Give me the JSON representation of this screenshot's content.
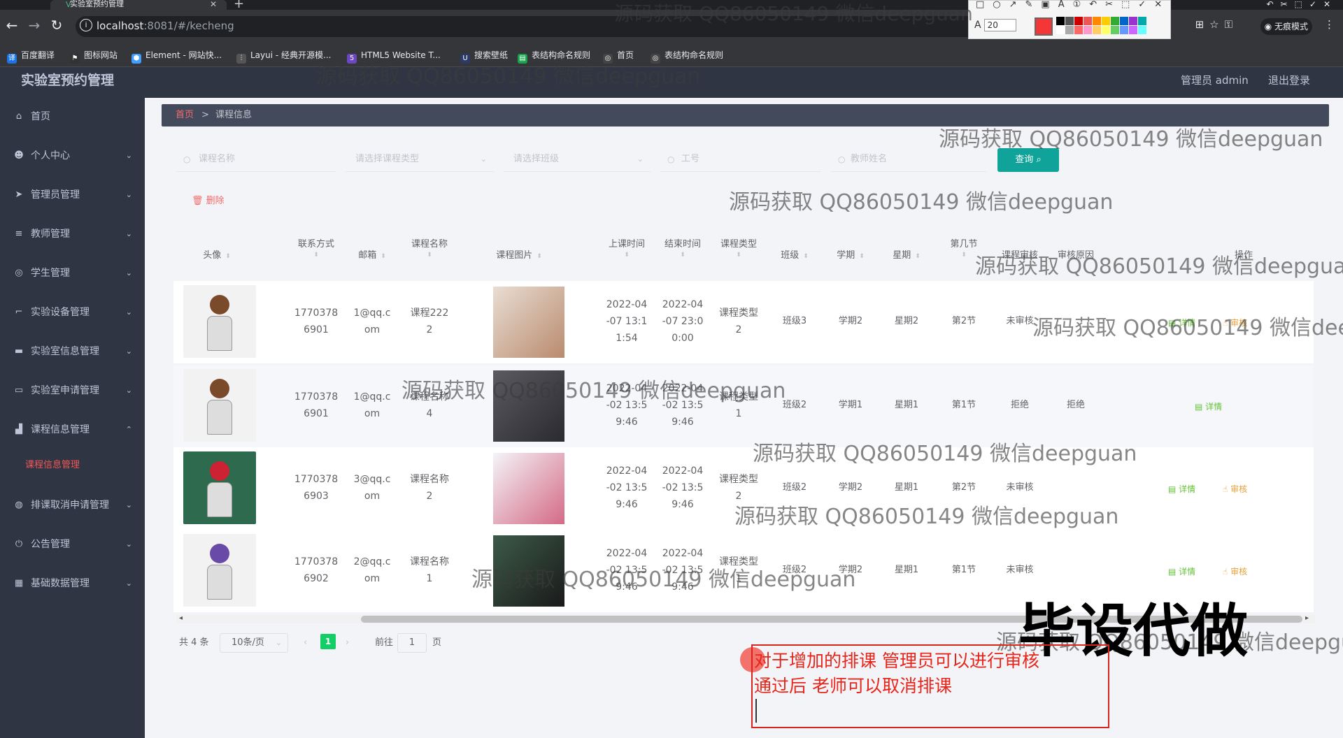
{
  "browser": {
    "tab_title": "实验室预约管理",
    "url_host": "localhost",
    "url_rest": ":8081/#/kecheng",
    "incognito_label": "无痕模式",
    "bookmarks": [
      "百度翻译",
      "图标网站",
      "Element - 网站快...",
      "Layui - 经典开源模...",
      "HTML5 Website T...",
      "搜索壁纸",
      "表结构命名规则",
      "首页",
      "表结构命名规则"
    ],
    "draw_size": "20"
  },
  "header": {
    "app_title": "实验室预约管理",
    "user_label": "管理员 admin",
    "logout_label": "退出登录"
  },
  "sidebar": {
    "items": [
      {
        "label": "首页",
        "icon": "home-icon"
      },
      {
        "label": "个人中心",
        "icon": "user-icon"
      },
      {
        "label": "管理员管理",
        "icon": "send-icon"
      },
      {
        "label": "教师管理",
        "icon": "menu-icon"
      },
      {
        "label": "学生管理",
        "icon": "compass-icon"
      },
      {
        "label": "实验设备管理",
        "icon": "crop-icon"
      },
      {
        "label": "实验室信息管理",
        "icon": "monitor-icon"
      },
      {
        "label": "实验室申请管理",
        "icon": "chat-icon"
      },
      {
        "label": "课程信息管理",
        "icon": "chart-icon"
      },
      {
        "label": "排课取消申请管理",
        "icon": "globe-icon"
      },
      {
        "label": "公告管理",
        "icon": "power-icon"
      },
      {
        "label": "基础数据管理",
        "icon": "grid-icon"
      }
    ],
    "active_sub": "课程信息管理"
  },
  "breadcrumb": {
    "home": "首页",
    "separator": ">",
    "current": "课程信息"
  },
  "filters": {
    "course_name_placeholder": "课程名称",
    "course_type_placeholder": "请选择课程类型",
    "class_placeholder": "请选择班级",
    "job_no_placeholder": "工号",
    "teacher_name_placeholder": "教师姓名",
    "search_label": "查询"
  },
  "toolbar": {
    "delete_label": "删除"
  },
  "table": {
    "headers": [
      "头像",
      "联系方式",
      "邮箱",
      "课程名称",
      "课程图片",
      "上课时间",
      "结束时间",
      "课程类型",
      "班级",
      "学期",
      "星期",
      "第几节",
      "课程审核",
      "审核原因",
      "操作"
    ],
    "rows": [
      {
        "phone1": "1770378",
        "phone2": "6901",
        "email1": "1@qq.c",
        "email2": "om",
        "name1": "课程222",
        "name2": "2",
        "start": [
          "2022-04",
          "-07 13:1",
          "1:54"
        ],
        "end": [
          "2022-04",
          "-07 23:0",
          "0:00"
        ],
        "type1": "课程类型",
        "type2": "2",
        "class": "班级3",
        "term": "学期2",
        "week": "星期2",
        "period": "第2节",
        "audit": "未审核",
        "reason": "",
        "detail": "详情",
        "audit_btn": "审核"
      },
      {
        "phone1": "1770378",
        "phone2": "6901",
        "email1": "1@qq.c",
        "email2": "om",
        "name1": "课程名称",
        "name2": "4",
        "start": [
          "2022-04",
          "-02 13:5",
          "9:46"
        ],
        "end": [
          "2022-04",
          "-02 13:5",
          "9:46"
        ],
        "type1": "课程类型",
        "type2": "1",
        "class": "班级2",
        "term": "学期1",
        "week": "星期1",
        "period": "第1节",
        "audit": "拒绝",
        "reason": "拒绝",
        "detail": "详情",
        "audit_btn": ""
      },
      {
        "phone1": "1770378",
        "phone2": "6903",
        "email1": "3@qq.c",
        "email2": "om",
        "name1": "课程名称",
        "name2": "2",
        "start": [
          "2022-04",
          "-02 13:5",
          "9:46"
        ],
        "end": [
          "2022-04",
          "-02 13:5",
          "9:46"
        ],
        "type1": "课程类型",
        "type2": "2",
        "class": "班级2",
        "term": "学期2",
        "week": "星期1",
        "period": "第2节",
        "audit": "未审核",
        "reason": "",
        "detail": "详情",
        "audit_btn": "审核"
      },
      {
        "phone1": "1770378",
        "phone2": "6902",
        "email1": "2@qq.c",
        "email2": "om",
        "name1": "课程名称",
        "name2": "1",
        "start": [
          "2022-04",
          "-02 13:5",
          "9:46"
        ],
        "end": [
          "2022-04",
          "-02 13:5",
          "9:46"
        ],
        "type1": "课程类型",
        "type2": "1",
        "class": "班级2",
        "term": "学期2",
        "week": "星期1",
        "period": "第1节",
        "audit": "未审核",
        "reason": "",
        "detail": "详情",
        "audit_btn": "审核"
      }
    ]
  },
  "pagination": {
    "total": "共 4 条",
    "page_size": "10条/页",
    "current_page": "1",
    "goto_prefix": "前往",
    "goto_value": "1",
    "goto_suffix": "页"
  },
  "watermark": "源码获取 QQ86050149 微信deepguan",
  "big_watermark": "毕设代做",
  "annotation": {
    "line1": "对于增加的排课  管理员可以进行审核",
    "line2": "通过后 老师可以取消排课"
  }
}
